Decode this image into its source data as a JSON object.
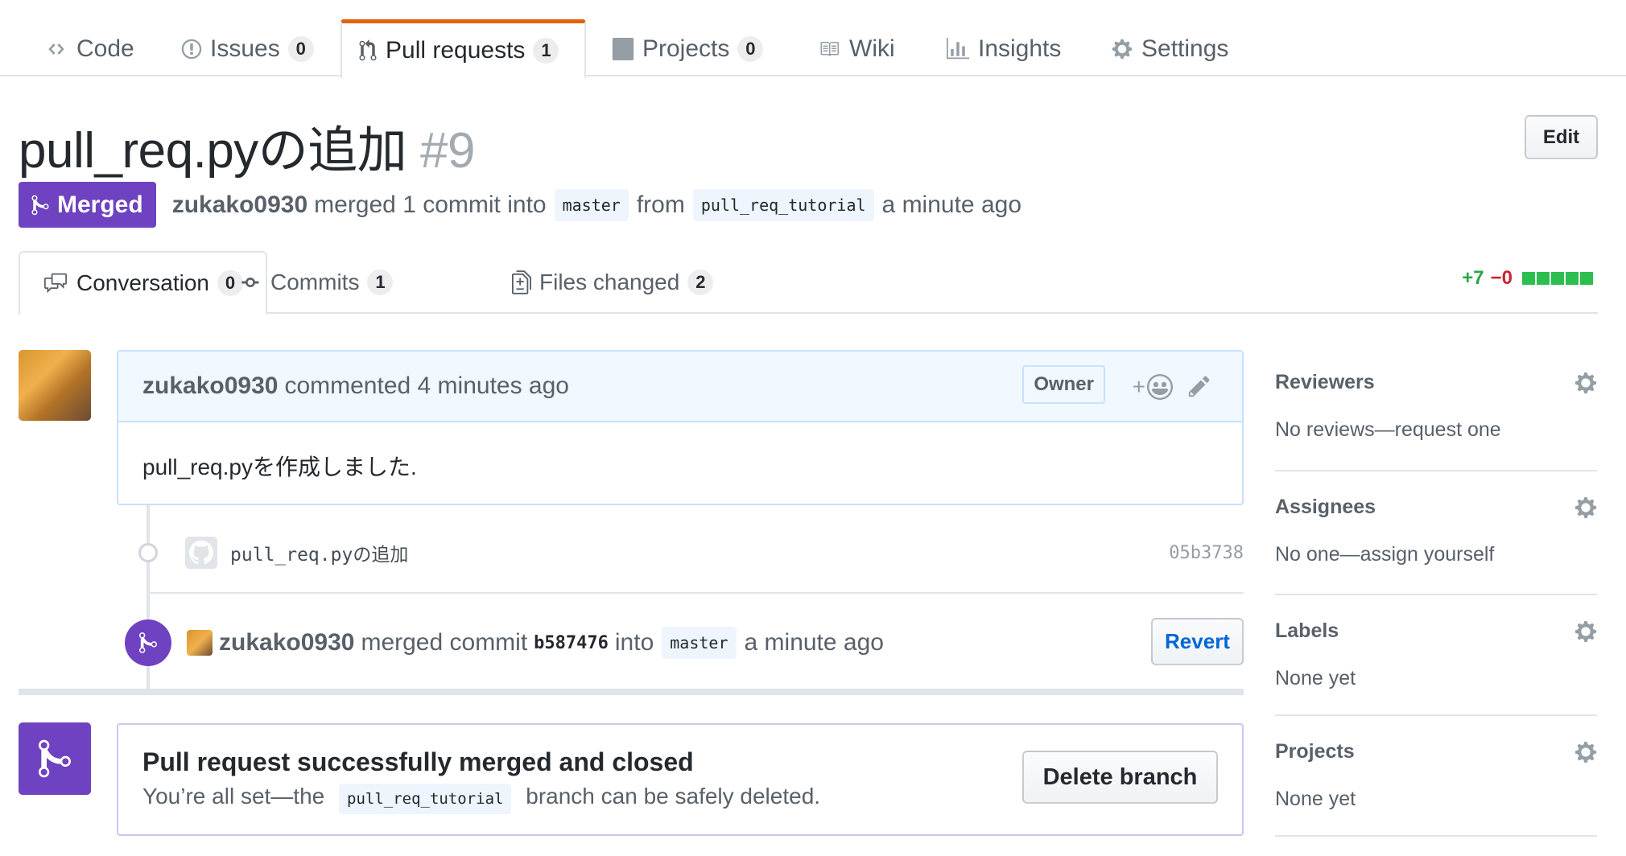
{
  "repo_nav": {
    "tabs": [
      {
        "label": "Code",
        "icon": "code-icon",
        "counter": null
      },
      {
        "label": "Issues",
        "icon": "issue-icon",
        "counter": "0"
      },
      {
        "label": "Pull requests",
        "icon": "pull-request-icon",
        "counter": "1",
        "selected": true
      },
      {
        "label": "Projects",
        "icon": "project-icon",
        "counter": "0"
      },
      {
        "label": "Wiki",
        "icon": "book-icon",
        "counter": null
      },
      {
        "label": "Insights",
        "icon": "graph-icon",
        "counter": null
      },
      {
        "label": "Settings",
        "icon": "gear-icon",
        "counter": null
      }
    ]
  },
  "header": {
    "title": "pull_req.pyの追加",
    "number": "#9",
    "edit_label": "Edit",
    "state_label": "Merged",
    "author": "zukako0930",
    "merged_text": "merged 1 commit into",
    "base_branch": "master",
    "from_text": "from",
    "head_branch": "pull_req_tutorial",
    "time": "a minute ago"
  },
  "pr_tabs": {
    "tabs": [
      {
        "label": "Conversation",
        "icon": "comment-discussion-icon",
        "counter": "0",
        "selected": true
      },
      {
        "label": "Commits",
        "icon": "commit-icon",
        "counter": "1"
      },
      {
        "label": "Files changed",
        "icon": "file-diff-icon",
        "counter": "2"
      }
    ],
    "diffstat": {
      "additions": "+7",
      "deletions": "−0",
      "blocks": 5
    }
  },
  "comment": {
    "author": "zukako0930",
    "action": "commented 4 minutes ago",
    "owner_label": "Owner",
    "reaction_label": "+",
    "body": "pull_req.pyを作成しました."
  },
  "commit": {
    "message": "pull_req.pyの追加",
    "sha": "05b3738"
  },
  "merge_event": {
    "author": "zukako0930",
    "text_before": "merged commit",
    "sha": "b587476",
    "into": "into",
    "branch": "master",
    "time": "a minute ago",
    "revert_label": "Revert"
  },
  "merge_box": {
    "title": "Pull request successfully merged and closed",
    "text_before": "You’re all set—the",
    "branch": "pull_req_tutorial",
    "text_after": "branch can be safely deleted.",
    "delete_label": "Delete branch"
  },
  "sidebar": {
    "items": [
      {
        "title": "Reviewers",
        "value": "No reviews—request one"
      },
      {
        "title": "Assignees",
        "value": "No one—assign yourself"
      },
      {
        "title": "Labels",
        "value": "None yet"
      },
      {
        "title": "Projects",
        "value": "None yet"
      }
    ]
  },
  "colors": {
    "merged_purple": "#6f42c1",
    "nav_accent": "#e36209",
    "link_blue": "#0366d6",
    "add_green": "#28a745",
    "del_red": "#cb2431"
  }
}
